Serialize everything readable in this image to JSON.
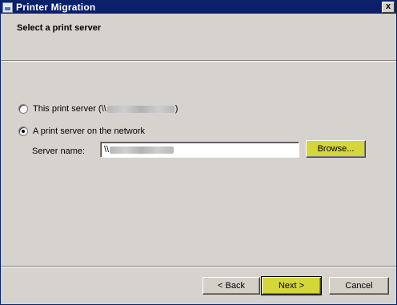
{
  "window": {
    "title": "Printer Migration",
    "close_glyph": "x"
  },
  "header": {
    "title": "Select a print server"
  },
  "options": {
    "this_server": {
      "label_prefix": "This print server (\\\\",
      "label_suffix": ")",
      "checked": false
    },
    "network_server": {
      "label": "A print server on the network",
      "checked": true
    }
  },
  "server_name": {
    "label": "Server name:",
    "value_prefix": "\\\\"
  },
  "buttons": {
    "browse": "Browse...",
    "back": "< Back",
    "next": "Next >",
    "cancel": "Cancel"
  },
  "colors": {
    "titlebar": "#0b1f6b",
    "highlight": "#d4d63a",
    "dialog_bg": "#d6d3ce"
  }
}
